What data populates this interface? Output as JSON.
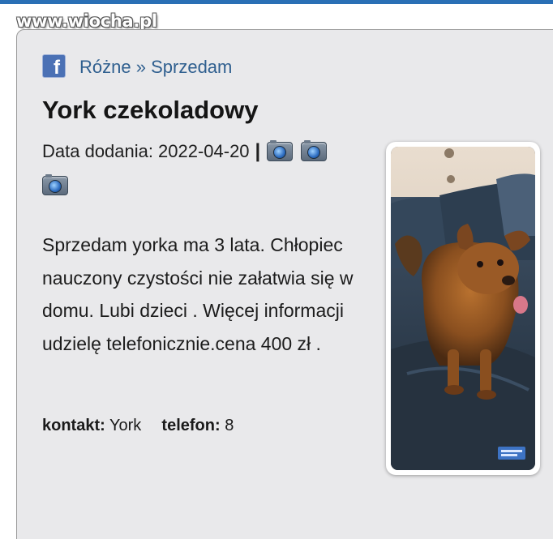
{
  "watermark": "www.wiocha.pl",
  "breadcrumb": {
    "category": "Różne",
    "separator": "»",
    "subcategory": "Sprzedam"
  },
  "listing": {
    "title": "York czekoladowy",
    "date_label": "Data dodania:",
    "date_value": "2022-04-20",
    "date_separator": "|",
    "description": "Sprzedam yorka ma 3 lata. Chłopiec nauczony czystości nie załatwia się w domu. Lubi dzieci . Więcej informacji udzielę telefonicznie.cena 400 zł .",
    "contact_label": "kontakt:",
    "contact_value": "York",
    "phone_label": "telefon:",
    "phone_value": "8"
  },
  "icons": {
    "facebook": "facebook-icon",
    "camera": "camera-icon"
  },
  "colors": {
    "top_bar": "#2a6fb5",
    "link": "#2f5f8f",
    "card_bg": "#e9e9eb",
    "facebook": "#4b71b5"
  }
}
